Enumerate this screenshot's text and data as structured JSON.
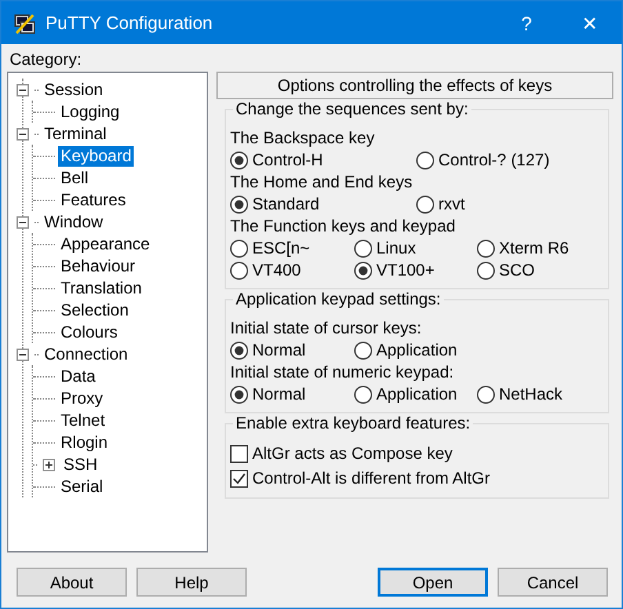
{
  "window": {
    "title": "PuTTY Configuration",
    "help": "?",
    "close": "✕"
  },
  "category_label": "Category:",
  "tree": [
    {
      "label": "Session",
      "expanded": true,
      "selected": false,
      "children": [
        {
          "label": "Logging",
          "selected": false
        }
      ]
    },
    {
      "label": "Terminal",
      "expanded": true,
      "selected": false,
      "children": [
        {
          "label": "Keyboard",
          "selected": true
        },
        {
          "label": "Bell",
          "selected": false
        },
        {
          "label": "Features",
          "selected": false
        }
      ]
    },
    {
      "label": "Window",
      "expanded": true,
      "selected": false,
      "children": [
        {
          "label": "Appearance",
          "selected": false
        },
        {
          "label": "Behaviour",
          "selected": false
        },
        {
          "label": "Translation",
          "selected": false
        },
        {
          "label": "Selection",
          "selected": false
        },
        {
          "label": "Colours",
          "selected": false
        }
      ]
    },
    {
      "label": "Connection",
      "expanded": true,
      "selected": false,
      "children": [
        {
          "label": "Data",
          "selected": false
        },
        {
          "label": "Proxy",
          "selected": false
        },
        {
          "label": "Telnet",
          "selected": false
        },
        {
          "label": "Rlogin",
          "selected": false
        },
        {
          "label": "SSH",
          "expanded": false,
          "selected": false
        },
        {
          "label": "Serial",
          "selected": false
        }
      ]
    }
  ],
  "panel": {
    "heading": "Options controlling the effects of keys",
    "groups": [
      {
        "title": "Change the sequences sent by:",
        "items": [
          {
            "kind": "label",
            "text": "The Backspace key"
          },
          {
            "kind": "pairs",
            "options": [
              {
                "label": "Control-H",
                "selected": true
              },
              {
                "label": "Control-? (127)",
                "selected": false
              }
            ]
          },
          {
            "kind": "label",
            "text": "The Home and End keys"
          },
          {
            "kind": "pairs",
            "options": [
              {
                "label": "Standard",
                "selected": true
              },
              {
                "label": "rxvt",
                "selected": false
              }
            ]
          },
          {
            "kind": "label",
            "text": "The Function keys and keypad"
          },
          {
            "kind": "triples",
            "options": [
              {
                "label": "ESC[n~",
                "selected": false
              },
              {
                "label": "Linux",
                "selected": false
              },
              {
                "label": "Xterm R6",
                "selected": false
              },
              {
                "label": "VT400",
                "selected": false
              },
              {
                "label": "VT100+",
                "selected": true
              },
              {
                "label": "SCO",
                "selected": false
              }
            ]
          }
        ]
      },
      {
        "title": "Application keypad settings:",
        "items": [
          {
            "kind": "label",
            "text": "Initial state of cursor keys:"
          },
          {
            "kind": "triples",
            "options": [
              {
                "label": "Normal",
                "selected": true
              },
              {
                "label": "Application",
                "selected": false
              }
            ]
          },
          {
            "kind": "label",
            "text": "Initial state of numeric keypad:"
          },
          {
            "kind": "triples",
            "options": [
              {
                "label": "Normal",
                "selected": true
              },
              {
                "label": "Application",
                "selected": false
              },
              {
                "label": "NetHack",
                "selected": false
              }
            ]
          }
        ]
      },
      {
        "title": "Enable extra keyboard features:",
        "items": [
          {
            "kind": "checkbox",
            "label": "AltGr acts as Compose key",
            "checked": false
          },
          {
            "kind": "checkbox",
            "label": "Control-Alt is different from AltGr",
            "checked": true
          }
        ]
      }
    ]
  },
  "buttons": [
    {
      "label": "About",
      "default": false
    },
    {
      "label": "Help",
      "default": false
    },
    {
      "label": "Open",
      "default": true
    },
    {
      "label": "Cancel",
      "default": false
    }
  ]
}
